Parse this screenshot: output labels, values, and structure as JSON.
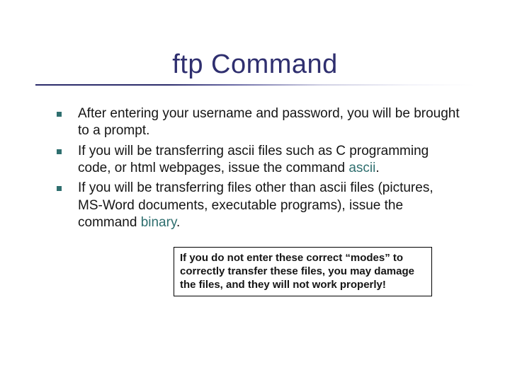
{
  "title": "ftp Command",
  "bullets": [
    {
      "text_before": "After entering your username and password, you will be brought to a prompt.",
      "keyword": "",
      "text_after": ""
    },
    {
      "text_before": "If you will be transferring ascii files such as C programming code, or html webpages, issue the command ",
      "keyword": "ascii",
      "text_after": "."
    },
    {
      "text_before": "If you will be transferring files other than ascii files (pictures, MS-Word documents, executable programs), issue the command ",
      "keyword": "binary",
      "text_after": "."
    }
  ],
  "note": "If you do not enter these correct “modes” to correctly transfer these files, you may damage the files, and they will not work properly!"
}
